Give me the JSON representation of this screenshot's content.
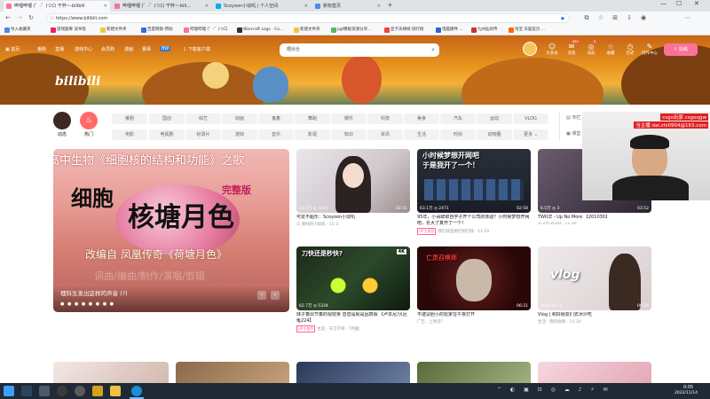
{
  "browser": {
    "tabs": [
      {
        "label": "哔哩哔哩 (゜-゜)つロ 干杯~-bilibili",
        "active": true,
        "color": "#fb7299"
      },
      {
        "label": "哔哩哔哩 (゜-゜)つロ 干杯~-bili...",
        "active": false,
        "color": "#fb7299"
      },
      {
        "label": "Scoyoon小幼叽 | 个人空间",
        "active": false,
        "color": "#00aeec"
      },
      {
        "label": "新标签页",
        "active": false,
        "color": "#4a90d9"
      }
    ],
    "url": "https://www.bilibili.com",
    "bookmarks": [
      "导入收藏夹",
      "游戏题库 读书笔",
      "新建文件夹",
      "百度网盘-赞助",
      "哔哩哔哩 (゜-゜)つロ",
      "Warcraft Logs · Co...",
      "新建文件夹",
      "pgf模板资源分享...",
      "显卡天梯榜 排行榜",
      "电脑硬件 ...",
      "九州仙剑传",
      "淘宝 天猫首页 ..."
    ]
  },
  "header": {
    "nav_items": [
      "首页",
      "番剧",
      "直播",
      "游戏中心",
      "会员购",
      "漫画",
      "赛事",
      "BW",
      "下载客户端"
    ],
    "search_placeholder": "晒出仓",
    "logo": "bilibili",
    "icons": [
      {
        "label": "大会员",
        "glyph": "☺",
        "badge": ""
      },
      {
        "label": "消息",
        "glyph": "✉",
        "badge": "99+"
      },
      {
        "label": "动态",
        "glyph": "◎",
        "badge": "5"
      },
      {
        "label": "收藏",
        "glyph": "☆",
        "badge": ""
      },
      {
        "label": "历史",
        "glyph": "◷",
        "badge": ""
      },
      {
        "label": "创作中心",
        "glyph": "✎",
        "badge": ""
      }
    ],
    "upload_label": "投稿"
  },
  "channels": {
    "dynamic_label": "动态",
    "hot_label": "热门",
    "row1": [
      "番剧",
      "国创",
      "综艺",
      "动画",
      "鬼畜",
      "舞蹈",
      "娱乐",
      "科技",
      "美食",
      "汽车",
      "运动",
      "VLOG"
    ],
    "row2": [
      "电影",
      "电视剧",
      "纪录片",
      "游戏",
      "音乐",
      "影视",
      "知识",
      "资讯",
      "生活",
      "时尚",
      "动物圈",
      "更多"
    ],
    "side_links": [
      "专栏",
      "直播",
      "活动",
      "课堂",
      "社区中心",
      "新歌热榜"
    ]
  },
  "carousel": {
    "top_text": "高中生物《细胞核的结构和功能》之歌",
    "big_text_1": "细胞",
    "big_text_2": "核塘月色",
    "tag": "完整版",
    "sub_text": "改编自 凤凰传奇《荷塘月色》",
    "ghost_text": "词曲/编曲/制作/演唱/剪辑",
    "caption": "理科生发出这样的声音 (?)"
  },
  "videos": [
    {
      "stats": "63.4万  ◎ 2453",
      "dur": "02:51",
      "title": "可爱不超乐：Scoyoon小幼叽",
      "meta": "☑ 清纯的小幼叽 · 11-3",
      "overlay": ""
    },
    {
      "stats": "63.1万  ◎ 2471",
      "dur": "02:58",
      "title": "95年，小哥辞职自学子开个公司的体验？小时候梦想开网吧，长大了真开了一个！",
      "meta": "",
      "overlay": "小时候梦想开网吧\n于是我开了一个！",
      "ad": true,
      "ad_label": "UP主推荐",
      "meta_ad": "我们就是想打闹打钱 · 11-10"
    },
    {
      "stats": "6.5万  ◎ 3",
      "dur": "03:52",
      "title": "TWICE - Up No More 【201030】",
      "meta": "☑ ZYCZLZH · 11-10",
      "overlay": ""
    },
    {
      "stats": "62.7万  ◎ 5334",
      "dur": "",
      "title": "妹子奏出节奏的视效果 音音是就是因真假 【卢本尼/贝尼龟224】",
      "meta": "生涯 · 守卫学校 · 7月截",
      "overlay": "刀快还是秒快?",
      "ad": true,
      "ad_label": "UP主推荐"
    },
    {
      "stats": "",
      "dur": "06:21",
      "title": "不建议胆小的玩家在午夜打开",
      "meta": "广告 · 上青云?",
      "overlay": "亡灵召唤师",
      "ad": false
    },
    {
      "stats": "0624  ◎ 11",
      "dur": "06:24",
      "title": "Vlog | 和好朋友们去冰沙吃",
      "meta": "生活 · 我的视频 · 11-10",
      "overlay": "vlog"
    }
  ],
  "stream": {
    "top": "csgo玩家 csgoqgw",
    "sub": "当主播 dai.zhi0904@163.com"
  },
  "taskbar": {
    "time": "0:05",
    "date": "2022/11/14"
  }
}
